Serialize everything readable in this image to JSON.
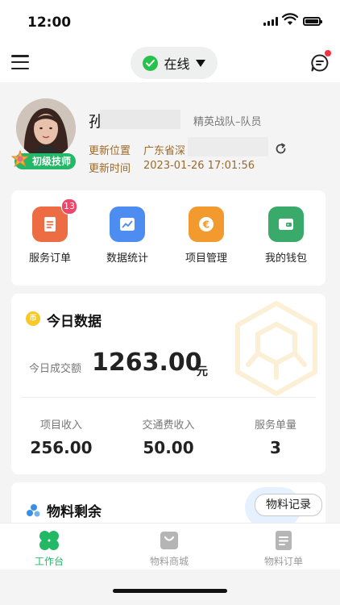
{
  "status_bar": {
    "time": "12:00"
  },
  "header": {
    "status_label": "在线"
  },
  "profile": {
    "name_visible": "孙",
    "team": "精英战队–队员",
    "level_badge": "初级技师",
    "location_label": "更新位置",
    "location_value": "广东省深",
    "time_label": "更新时间",
    "time_value": "2023-01-26  17:01:56"
  },
  "quick_actions": [
    {
      "label": "服务订单",
      "icon": "document-icon",
      "color": "#ee6c43",
      "badge": "13"
    },
    {
      "label": "数据统计",
      "icon": "chart-icon",
      "color": "#4d8cf0"
    },
    {
      "label": "项目管理",
      "icon": "euro-coin-icon",
      "color": "#f29a2e"
    },
    {
      "label": "我的钱包",
      "icon": "wallet-icon",
      "color": "#3aaa6a"
    }
  ],
  "today_data": {
    "title": "今日数据",
    "coin_glyph": "币",
    "deal_label": "今日成交额",
    "deal_value": "1263.00",
    "deal_unit": "元",
    "stats": [
      {
        "label": "项目收入",
        "value": "256.00"
      },
      {
        "label": "交通费收入",
        "value": "50.00"
      },
      {
        "label": "服务单量",
        "value": "3"
      }
    ]
  },
  "materials": {
    "title": "物料剩余",
    "record_button": "物料记录"
  },
  "tabs": [
    {
      "label": "工作台",
      "active": true,
      "icon": "workbench-icon"
    },
    {
      "label": "物料商城",
      "active": false,
      "icon": "shopping-bag-icon"
    },
    {
      "label": "物料订单",
      "active": false,
      "icon": "order-icon"
    }
  ],
  "colors": {
    "accent_green": "#22b866",
    "active_tab": "#22b866",
    "inactive_tab": "#9a9a9a",
    "badge": "#f0466a"
  }
}
